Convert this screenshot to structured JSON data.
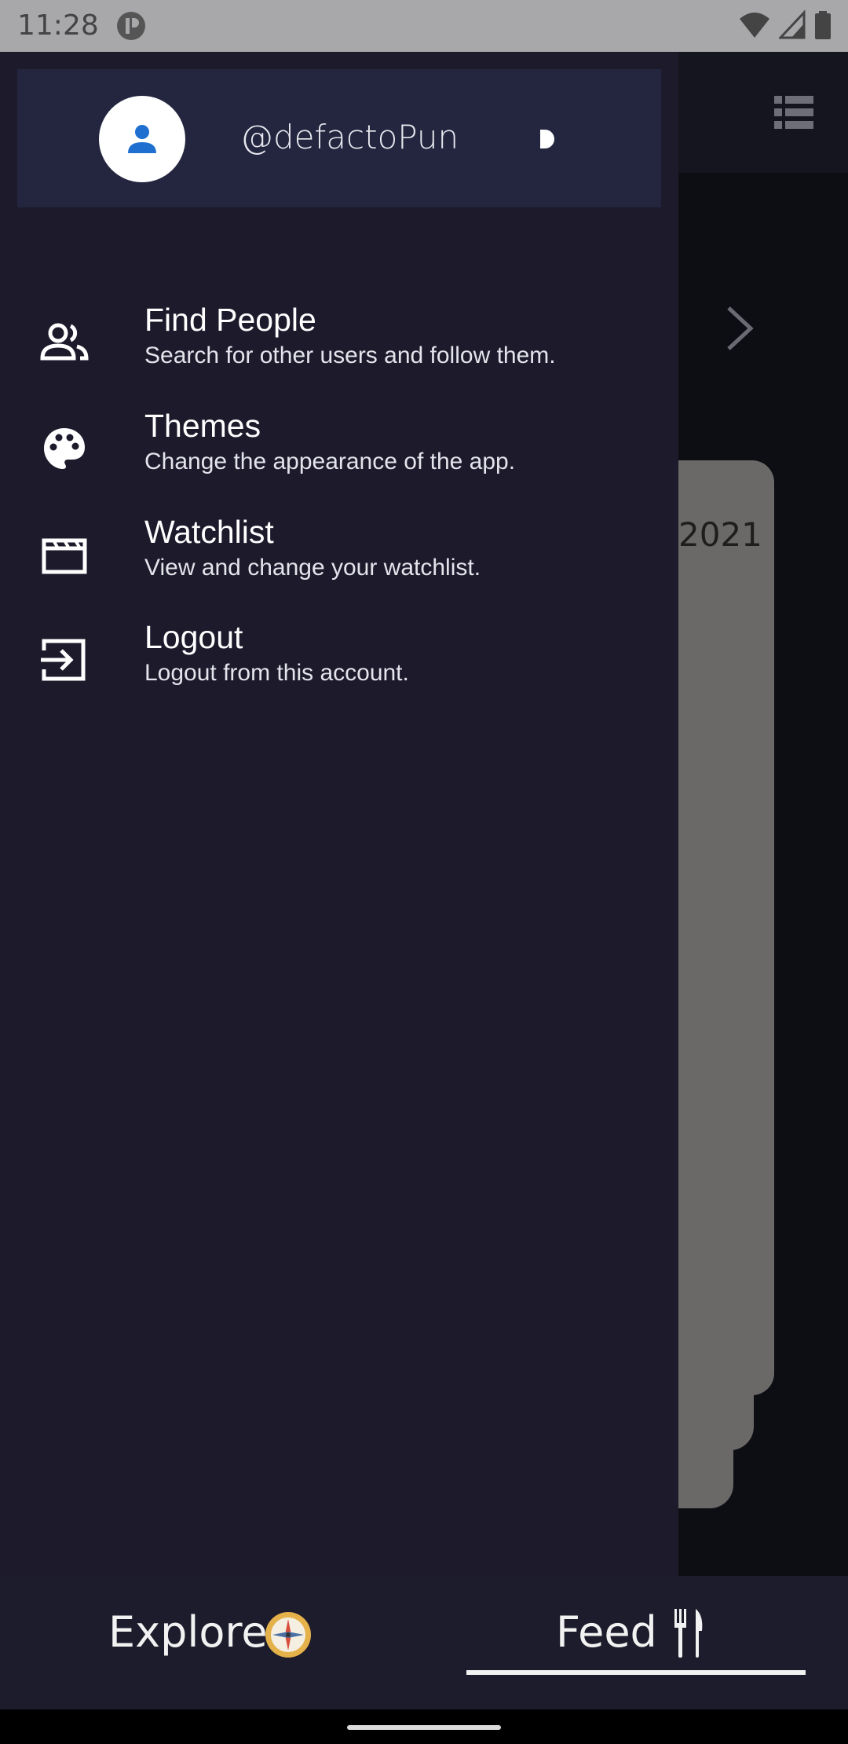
{
  "status_bar": {
    "time": "11:28"
  },
  "background": {
    "card_text": "2021"
  },
  "drawer": {
    "profile": {
      "username": "@defactoPun"
    },
    "menu": [
      {
        "title": "Find People",
        "subtitle": "Search for other users and follow them.",
        "icon": "people-icon"
      },
      {
        "title": "Themes",
        "subtitle": "Change the appearance of the app.",
        "icon": "palette-icon"
      },
      {
        "title": "Watchlist",
        "subtitle": "View and change your watchlist.",
        "icon": "clapperboard-icon"
      },
      {
        "title": "Logout",
        "subtitle": "Logout from this account.",
        "icon": "logout-icon"
      }
    ]
  },
  "bottom_nav": {
    "explore_label": "Explore",
    "feed_label": "Feed",
    "active": "feed"
  },
  "colors": {
    "drawer_bg": "#1c1a2b",
    "profile_bg": "#242640",
    "avatar_icon": "#1e6fcf",
    "nav_bg": "#1d1c2c"
  }
}
